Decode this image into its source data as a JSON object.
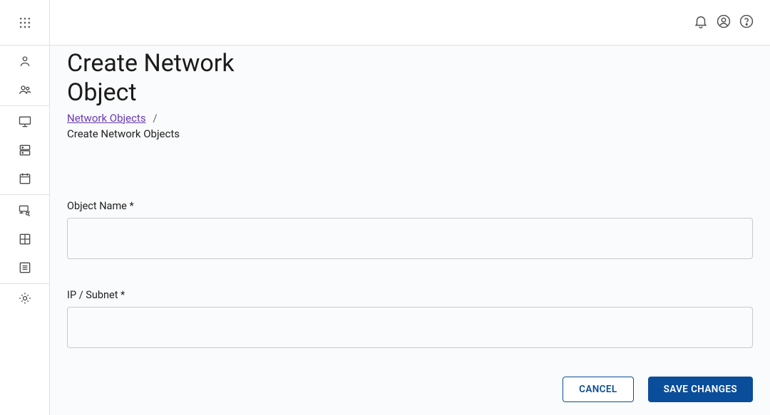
{
  "page": {
    "title": "Create Network Object"
  },
  "breadcrumb": {
    "link_label": "Network Objects",
    "separator": "/",
    "current": "Create Network Objects"
  },
  "form": {
    "object_name_label": "Object Name *",
    "object_name_value": "",
    "ip_subnet_label": "IP / Subnet *",
    "ip_subnet_value": ""
  },
  "buttons": {
    "cancel": "CANCEL",
    "save": "SAVE CHANGES"
  }
}
